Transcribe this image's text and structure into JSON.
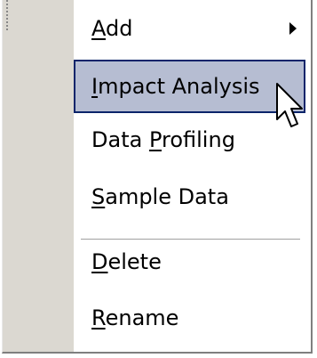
{
  "menu": {
    "items": [
      {
        "pre": "",
        "mnemonic": "A",
        "post": "dd",
        "has_submenu": true,
        "submenu_icon": "chevron-right-icon"
      },
      {
        "pre": "",
        "mnemonic": "I",
        "post": "mpact Analysis",
        "highlighted": true
      },
      {
        "pre": "Data ",
        "mnemonic": "P",
        "post": "rofiling"
      },
      {
        "pre": "",
        "mnemonic": "S",
        "post": "ample Data"
      },
      {
        "pre": "",
        "mnemonic": "D",
        "post": "elete"
      },
      {
        "pre": "",
        "mnemonic": "R",
        "post": "ename"
      }
    ],
    "highlight_bg": "#b6bdd2",
    "highlight_border": "#0a246a",
    "gutter_color": "#dbd8d1",
    "cursor_icon": "mouse-pointer-icon"
  }
}
